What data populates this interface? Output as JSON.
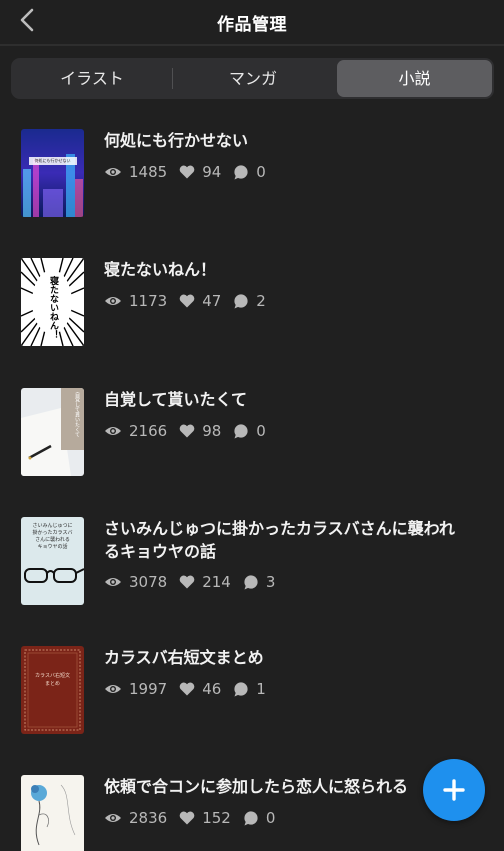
{
  "header": {
    "title": "作品管理",
    "back_icon": "chevron-left-icon"
  },
  "tabs": [
    {
      "label": "イラスト",
      "selected": false
    },
    {
      "label": "マンガ",
      "selected": false
    },
    {
      "label": "小説",
      "selected": true
    }
  ],
  "works": [
    {
      "title_lines": [
        "何処にも行かせない"
      ],
      "views": "1485",
      "likes": "94",
      "comments": "0",
      "cover_text": "何処にも行かせない"
    },
    {
      "title_lines": [
        "寝たないねん！"
      ],
      "views": "1173",
      "likes": "47",
      "comments": "2",
      "cover_text": "寝たないねん！"
    },
    {
      "title_lines": [
        "自覚して貰いたくて"
      ],
      "views": "2166",
      "likes": "98",
      "comments": "0",
      "cover_text": "自覚して貰いたくて"
    },
    {
      "title_lines": [
        "さいみんじゅつに掛かったカラスバさんに襲われ",
        "るキョウヤの話"
      ],
      "views": "3078",
      "likes": "214",
      "comments": "3",
      "cover_text": [
        "さいみんじゅつに",
        "掛かったカラスバ",
        "さんに襲われる",
        "キョウヤの話"
      ]
    },
    {
      "title_lines": [
        "カラスバ右短文まとめ"
      ],
      "views": "1997",
      "likes": "46",
      "comments": "1",
      "cover_text": [
        "カラスバ右短文",
        "まとめ"
      ]
    },
    {
      "title_lines": [
        "依頼で合コンに参加したら恋人に怒られる"
      ],
      "views": "2836",
      "likes": "152",
      "comments": "0",
      "cover_text": ""
    }
  ],
  "fab": {
    "label": "+",
    "icon": "plus-icon"
  },
  "colors": {
    "background": "#202020",
    "accent": "#1e90ee",
    "segment_bg": "#2f2f31",
    "segment_selected": "#5d5d60"
  }
}
